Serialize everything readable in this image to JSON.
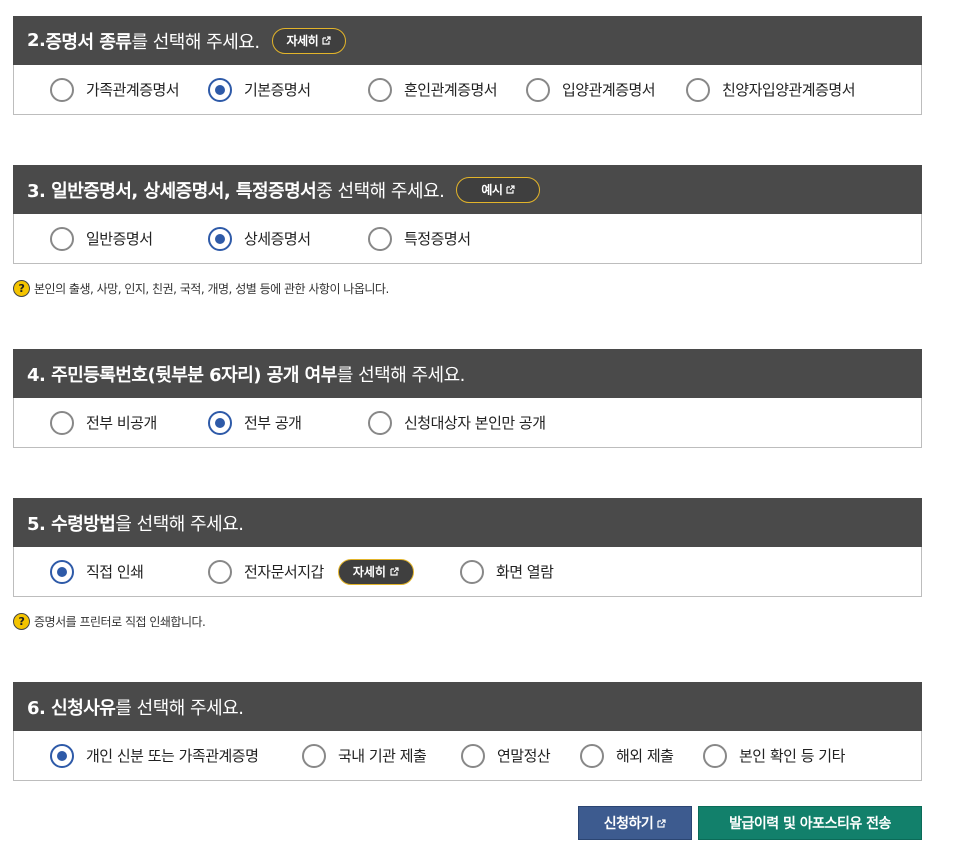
{
  "sec2": {
    "num": "2. ",
    "bold": "증명서 종류",
    "rest": "를 선택해 주세요.",
    "pill": "자세히",
    "options": [
      {
        "label": "가족관계증명서",
        "selected": false
      },
      {
        "label": "기본증명서",
        "selected": true
      },
      {
        "label": "혼인관계증명서",
        "selected": false
      },
      {
        "label": "입양관계증명서",
        "selected": false
      },
      {
        "label": "친양자입양관계증명서",
        "selected": false
      }
    ]
  },
  "sec3": {
    "bold": "3. 일반증명서, 상세증명서, 특정증명서",
    "rest": " 중 선택해 주세요.",
    "pill": "예시",
    "options": [
      {
        "label": "일반증명서",
        "selected": false
      },
      {
        "label": "상세증명서",
        "selected": true
      },
      {
        "label": "특정증명서",
        "selected": false
      }
    ],
    "hint": "본인의 출생, 사망, 인지, 친권, 국적, 개명, 성별 등에 관한 사항이 나옵니다."
  },
  "sec4": {
    "bold": "4. 주민등록번호(뒷부분 6자리) 공개 여부",
    "rest": "를 선택해 주세요.",
    "options": [
      {
        "label": "전부 비공개",
        "selected": false
      },
      {
        "label": "전부 공개",
        "selected": true
      },
      {
        "label": "신청대상자 본인만 공개",
        "selected": false
      }
    ]
  },
  "sec5": {
    "bold": "5. 수령방법",
    "rest": "을 선택해 주세요.",
    "options": [
      {
        "label": "직접 인쇄",
        "selected": true
      },
      {
        "label": "전자문서지갑",
        "selected": false
      },
      {
        "label": "화면 열람",
        "selected": false
      }
    ],
    "pill": "자세히",
    "hint": "증명서를 프린터로 직접 인쇄합니다."
  },
  "sec6": {
    "bold": "6. 신청사유",
    "rest": "를 선택해 주세요.",
    "options": [
      {
        "label": "개인 신분 또는 가족관계증명",
        "selected": true
      },
      {
        "label": "국내 기관 제출",
        "selected": false
      },
      {
        "label": "연말정산",
        "selected": false
      },
      {
        "label": "해외 제출",
        "selected": false
      },
      {
        "label": "본인 확인 등 기타",
        "selected": false
      }
    ]
  },
  "hint_icon": "question-icon",
  "buttons": {
    "apply": "신청하기",
    "send": "발급이력 및 아포스티유 전송"
  },
  "colors": {
    "header_bg": "#4a4a4a",
    "radio_selected": "#2e5aa8",
    "pill_border": "#e2b42a",
    "apply_bg": "#3d5b8f",
    "send_bg": "#12806b"
  }
}
